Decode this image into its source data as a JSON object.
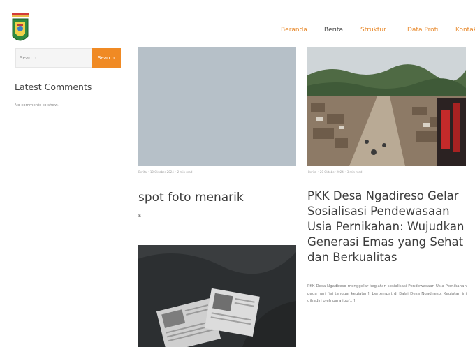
{
  "header": {
    "logo": "Kabupaten Malang coat of arms",
    "nav": [
      "Beranda",
      "Berita",
      "Struktur",
      "Data Profil",
      "Kontak"
    ],
    "active_nav_index": 1
  },
  "sidebar": {
    "search": {
      "placeholder": "Search...",
      "button_label": "Search"
    },
    "widget_title": "Latest Comments",
    "widget_empty_text": "No comments to show."
  },
  "posts": [
    {
      "meta": "Berita • 10 Oktober 2024 • 2 min read",
      "title": "spot foto menarik",
      "excerpt": "s",
      "image": "placeholder"
    },
    {
      "meta": "Berita • 20 Oktober 2024 • 3 min read",
      "title": "PKK Desa Ngadireso Gelar Sosialisasi Pendewasaan Usia Pernikahan: Wujudkan Generasi Emas yang Sehat dan Berkualitas",
      "excerpt": "PKK Desa Ngadireso menggelar kegiatan sosialisasi Pendewasaan Usia Pernikahan pada hari [isi tanggal kegiatan], bertempat di Balai Desa Ngadireso. Kegiatan ini dihadiri oleh para ibu[...]",
      "image": "aerial view of village road with houses and trees"
    },
    {
      "image": "old newspapers on dark fabric"
    }
  ],
  "colors": {
    "accent": "#f08a24",
    "nav_text": "#e8892b",
    "placeholder_image": "#b6c0c8"
  }
}
